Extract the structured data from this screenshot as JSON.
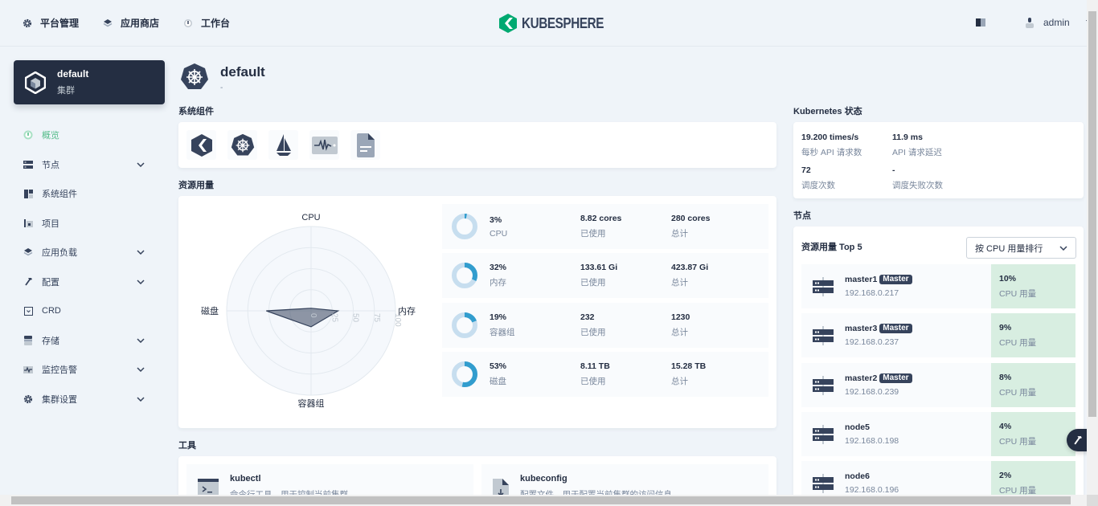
{
  "topnav": {
    "items": [
      {
        "label": "平台管理",
        "icon": "gear-icon"
      },
      {
        "label": "应用商店",
        "icon": "appstore-icon"
      },
      {
        "label": "工作台",
        "icon": "dashboard-icon"
      }
    ],
    "brand": "KUBESPHERE",
    "user": "admin"
  },
  "cluster": {
    "name": "default",
    "type": "集群"
  },
  "sidebar": {
    "items": [
      {
        "label": "概览",
        "active": true,
        "expandable": false
      },
      {
        "label": "节点",
        "expandable": true
      },
      {
        "label": "系统组件",
        "expandable": false
      },
      {
        "label": "项目",
        "expandable": false
      },
      {
        "label": "应用负载",
        "expandable": true
      },
      {
        "label": "配置",
        "expandable": true
      },
      {
        "label": "CRD",
        "expandable": false
      },
      {
        "label": "存储",
        "expandable": true
      },
      {
        "label": "监控告警",
        "expandable": true
      },
      {
        "label": "集群设置",
        "expandable": true
      }
    ]
  },
  "page": {
    "title": "default",
    "description": "-"
  },
  "sections": {
    "components": "系统组件",
    "resources": "资源用量",
    "tools": "工具",
    "k8s_status": "Kubernetes 状态",
    "nodes": "节点"
  },
  "components": [
    "kubesphere-icon",
    "kubernetes-icon",
    "istio-icon",
    "monitoring-icon",
    "logging-icon"
  ],
  "radar": {
    "axes": [
      "CPU",
      "内存",
      "容器组",
      "磁盘"
    ],
    "values": [
      3,
      32,
      19,
      53
    ],
    "ticks": [
      "0",
      "25",
      "50",
      "75",
      "100"
    ]
  },
  "usage": [
    {
      "percent": "3%",
      "value": 3,
      "name": "CPU",
      "used": "8.82 cores",
      "used_label": "已使用",
      "total": "280 cores",
      "total_label": "总计"
    },
    {
      "percent": "32%",
      "value": 32,
      "name": "内存",
      "used": "133.61 Gi",
      "used_label": "已使用",
      "total": "423.87 Gi",
      "total_label": "总计"
    },
    {
      "percent": "19%",
      "value": 19,
      "name": "容器组",
      "used": "232",
      "used_label": "已使用",
      "total": "1230",
      "total_label": "总计"
    },
    {
      "percent": "53%",
      "value": 53,
      "name": "磁盘",
      "used": "8.11 TB",
      "used_label": "已使用",
      "total": "15.28 TB",
      "total_label": "总计"
    }
  ],
  "tools": [
    {
      "title": "kubectl",
      "desc": "命令行工具，用于控制当前集群"
    },
    {
      "title": "kubeconfig",
      "desc": "配置文件，用于配置当前集群的访问信息"
    }
  ],
  "k8s": [
    {
      "value": "19.200 times/s",
      "label": "每秒 API 请求数"
    },
    {
      "value": "11.9 ms",
      "label": "API 请求延迟"
    },
    {
      "value": "72",
      "label": "调度次数"
    },
    {
      "value": "-",
      "label": "调度失败次数"
    }
  ],
  "nodes": {
    "title": "资源用量 Top 5",
    "sort_label": "按 CPU 用量排行",
    "items": [
      {
        "name": "master1",
        "role": "Master",
        "ip": "192.168.0.217",
        "cpu": "10%",
        "cpu_label": "CPU 用量"
      },
      {
        "name": "master3",
        "role": "Master",
        "ip": "192.168.0.237",
        "cpu": "9%",
        "cpu_label": "CPU 用量"
      },
      {
        "name": "master2",
        "role": "Master",
        "ip": "192.168.0.239",
        "cpu": "8%",
        "cpu_label": "CPU 用量"
      },
      {
        "name": "node5",
        "role": "",
        "ip": "192.168.0.198",
        "cpu": "4%",
        "cpu_label": "CPU 用量"
      },
      {
        "name": "node6",
        "role": "",
        "ip": "192.168.0.196",
        "cpu": "2%",
        "cpu_label": "CPU 用量"
      }
    ]
  },
  "colors": {
    "accent": "#55bc8a",
    "dark": "#242e42",
    "donut": "#329dce",
    "donut_bg": "#c7deef",
    "cpu_bg": "#d8eee1"
  }
}
